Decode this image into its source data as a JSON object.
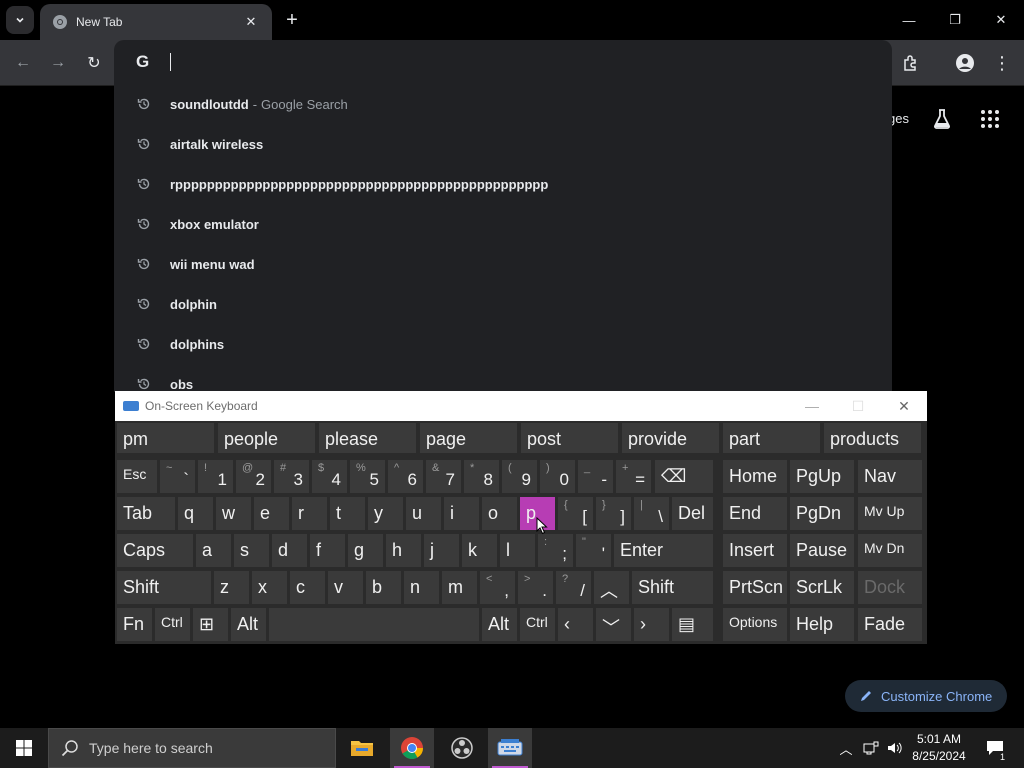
{
  "browser": {
    "tab_title": "New Tab",
    "omnibox_value": "",
    "suggestions": [
      {
        "text": "soundloutdd",
        "suffix": "Google Search"
      },
      {
        "text": "airtalk wireless",
        "suffix": ""
      },
      {
        "text": "rppppppppppppppppppppppppppppppppppppppppppppppp",
        "suffix": ""
      },
      {
        "text": "xbox emulator",
        "suffix": ""
      },
      {
        "text": "wii menu wad",
        "suffix": ""
      },
      {
        "text": "dolphin",
        "suffix": ""
      },
      {
        "text": "dolphins",
        "suffix": ""
      },
      {
        "text": "obs",
        "suffix": ""
      }
    ],
    "ntp_images_partial": "ges",
    "customize_label": "Customize Chrome"
  },
  "osk": {
    "title": "On-Screen Keyboard",
    "predictions": [
      "pm",
      "people",
      "please",
      "page",
      "post",
      "provide",
      "part",
      "products"
    ],
    "active_key": "p"
  },
  "taskbar": {
    "search_placeholder": "Type here to search",
    "time": "5:01 AM",
    "date": "8/25/2024",
    "notification_count": "1"
  },
  "colors": {
    "accent": "#b73db4",
    "link": "#8ab4f8",
    "omnibox_bg": "#202124",
    "key_bg": "#3a3a3a"
  }
}
